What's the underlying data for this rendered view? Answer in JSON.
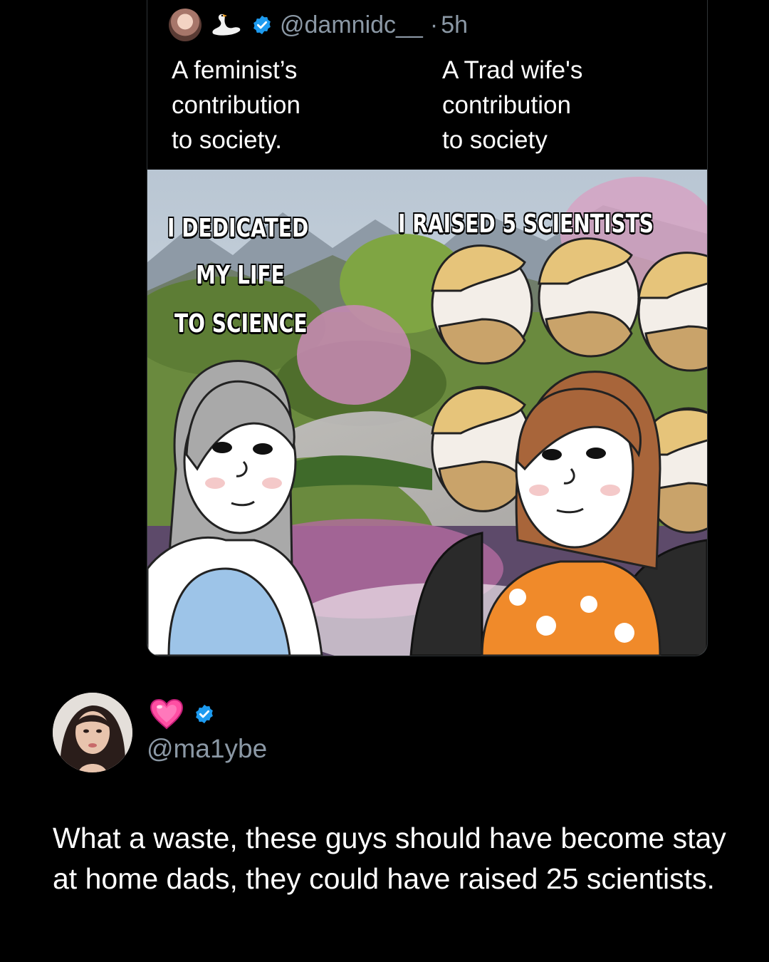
{
  "quoted_tweet": {
    "handle": "@damnidc__",
    "separator": "·",
    "time": "5h",
    "icons": [
      "avatar",
      "swan-icon",
      "verified-icon"
    ],
    "captions": {
      "left": "A feminist’s\ncontribution\nto society.",
      "right": "A Trad wife's\ncontribution\n to society"
    },
    "meme": {
      "left_text": [
        "I DEDICATED",
        "MY LIFE",
        "TO SCIENCE"
      ],
      "right_text": "I RAISED 5 SCIENTISTS"
    }
  },
  "reply": {
    "name_icon": "heart-icon",
    "verified": true,
    "handle": "@ma1ybe",
    "text": "What a waste, these guys should have become stay at home dads, they could have raised 25 scientists."
  },
  "colors": {
    "background": "#000000",
    "text": "#ffffff",
    "muted": "#8b98a5",
    "verified_blue": "#1d9bf0",
    "heart_pink": "#ff4fa3"
  }
}
